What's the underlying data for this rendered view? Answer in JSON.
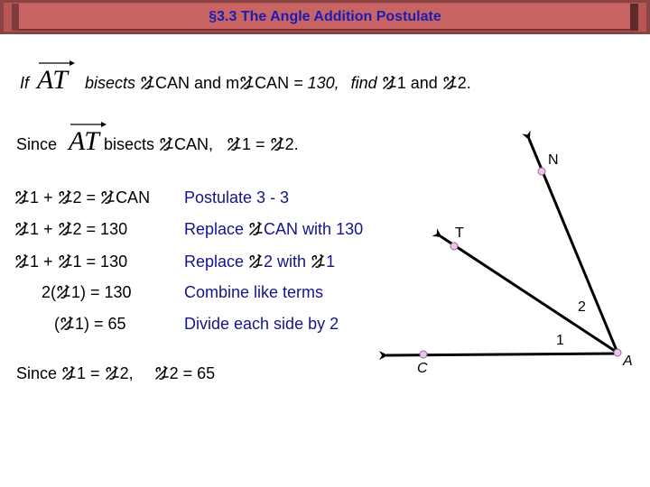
{
  "title": "§3.3  The Angle Addition Postulate",
  "problem": {
    "if": "If",
    "ray": "AT",
    "bisects": "bisects",
    "angle1_name": "CAN",
    "and1": "and  m",
    "angle2_name": "CAN",
    "equals_value": " = 130,",
    "find": "find",
    "find_a": "1  and ",
    "find_b": "2."
  },
  "since_line": {
    "since": "Since",
    "ray": "AT",
    "bisects": "bisects",
    "angle_name": "CAN,",
    "a": "1  = ",
    "b": "2."
  },
  "steps": [
    {
      "lhs_parts": [
        "1 + ",
        "2  =  ",
        "CAN"
      ],
      "reason_parts": [
        "Postulate 3 - 3"
      ]
    },
    {
      "lhs_parts": [
        "1 + ",
        "2  =  130"
      ],
      "reason_parts": [
        "Replace ",
        "CAN with 130"
      ]
    },
    {
      "lhs_parts": [
        "1 + ",
        "1  =  130"
      ],
      "reason_parts": [
        "Replace ",
        "2 with ",
        "1"
      ]
    },
    {
      "lhs_parts": [
        "2(",
        "1) =  130"
      ],
      "reason_parts": [
        "Combine like terms"
      ]
    },
    {
      "lhs_parts": [
        "(",
        "1) =  65"
      ],
      "reason_parts": [
        "Divide each side by 2"
      ]
    }
  ],
  "conclusion": {
    "a": "Since ",
    "b": "1  =  ",
    "c": "2,",
    "d": "2 = 65"
  },
  "diagram": {
    "points": {
      "N": "N",
      "T": "T",
      "C": "C",
      "A": "A"
    },
    "angle_labels": {
      "one": "1",
      "two": "2"
    },
    "point_color": "#e8c8e8"
  },
  "colors": {
    "title": "#1c1cb4",
    "reason": "#14148c",
    "banner": "#c96464"
  }
}
